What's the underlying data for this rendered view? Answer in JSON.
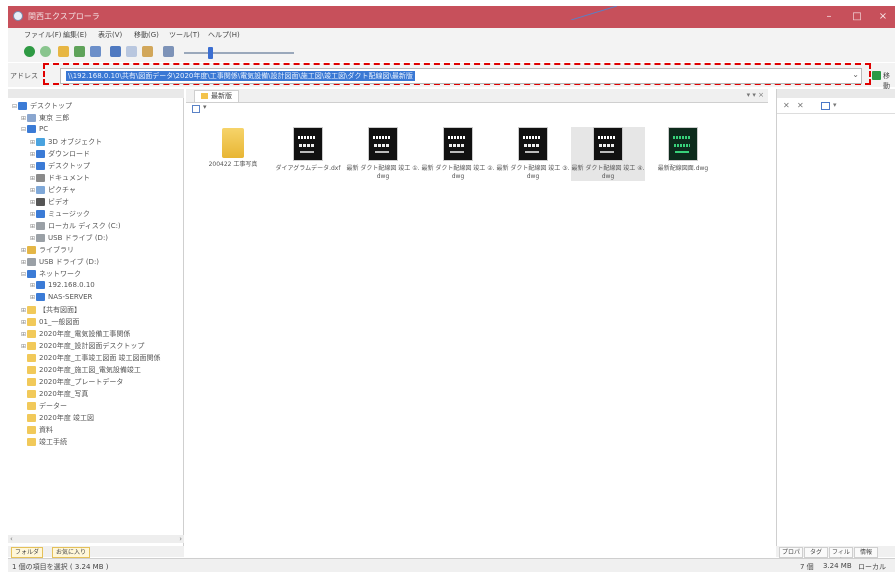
{
  "window": {
    "title": "関西エクスプローラ",
    "minimize": "–",
    "maximize": "□",
    "close": "×"
  },
  "menu": [
    "ファイル(F)",
    "編集(E)",
    "表示(V)",
    "移動(G)",
    "ツール(T)",
    "ヘルプ(H)"
  ],
  "toolbar": {
    "icons": [
      "back-icon",
      "forward-icon",
      "up-folder-icon",
      "home-icon",
      "refresh-icon",
      "copy-icon",
      "paste-icon",
      "delete-icon",
      "view-mode-icon"
    ]
  },
  "address": {
    "label": "アドレス",
    "value": "\\\\192.168.0.10\\共有\\図面データ\\2020年度\\工事関係\\電気設備\\設計図面\\施工図\\竣工図\\ダクト配線図\\最新版",
    "go_label": "移動"
  },
  "tree": {
    "items": [
      {
        "label": "デスクトップ",
        "icon": "desktop-icon",
        "color": "#3b7bd6",
        "indent": 0,
        "exp": "⊟"
      },
      {
        "label": "東京 三郎",
        "icon": "user-icon",
        "color": "#8aa6cf",
        "indent": 1,
        "exp": "⊞"
      },
      {
        "label": "PC",
        "icon": "pc-icon",
        "color": "#3b7bd6",
        "indent": 1,
        "exp": "⊟"
      },
      {
        "label": "3D オブジェクト",
        "icon": "3d-objects-icon",
        "color": "#4aa3df",
        "indent": 2,
        "exp": "⊞"
      },
      {
        "label": "ダウンロード",
        "icon": "download-icon",
        "color": "#3b7bd6",
        "indent": 2,
        "exp": "⊞"
      },
      {
        "label": "デスクトップ",
        "icon": "desktop-icon",
        "color": "#3b7bd6",
        "indent": 2,
        "exp": "⊞"
      },
      {
        "label": "ドキュメント",
        "icon": "documents-icon",
        "color": "#8a8a8a",
        "indent": 2,
        "exp": "⊞"
      },
      {
        "label": "ピクチャ",
        "icon": "pictures-icon",
        "color": "#7fa8d8",
        "indent": 2,
        "exp": "⊞"
      },
      {
        "label": "ビデオ",
        "icon": "videos-icon",
        "color": "#555555",
        "indent": 2,
        "exp": "⊞"
      },
      {
        "label": "ミュージック",
        "icon": "music-icon",
        "color": "#3b7bd6",
        "indent": 2,
        "exp": "⊞"
      },
      {
        "label": "ローカル ディスク (C:)",
        "icon": "drive-icon",
        "color": "#9aa0a6",
        "indent": 2,
        "exp": "⊞"
      },
      {
        "label": "USB ドライブ (D:)",
        "icon": "usb-drive-icon",
        "color": "#9aa0a6",
        "indent": 2,
        "exp": "⊞"
      },
      {
        "label": "ライブラリ",
        "icon": "library-icon",
        "color": "#e4b646",
        "indent": 1,
        "exp": "⊞"
      },
      {
        "label": "USB ドライブ (D:)",
        "icon": "usb-drive-icon",
        "color": "#9aa0a6",
        "indent": 1,
        "exp": "⊞"
      },
      {
        "label": "ネットワーク",
        "icon": "network-icon",
        "color": "#3b7bd6",
        "indent": 1,
        "exp": "⊟"
      },
      {
        "label": "192.168.0.10",
        "icon": "server-icon",
        "color": "#3b7bd6",
        "indent": 2,
        "exp": "⊞"
      },
      {
        "label": "NAS-SERVER",
        "icon": "server-icon",
        "color": "#3b7bd6",
        "indent": 2,
        "exp": "⊞"
      },
      {
        "label": "【共有図面】",
        "icon": "folder-icon",
        "color": "#f1c95a",
        "indent": 1,
        "exp": "⊞"
      },
      {
        "label": "01_一般図面",
        "icon": "folder-icon",
        "color": "#f1c95a",
        "indent": 1,
        "exp": "⊞"
      },
      {
        "label": "2020年度_電気設備工事関係",
        "icon": "folder-icon",
        "color": "#f1c95a",
        "indent": 1,
        "exp": "⊞"
      },
      {
        "label": "2020年度_設計図面デスクトップ",
        "icon": "folder-icon",
        "color": "#f1c95a",
        "indent": 1,
        "exp": "⊞"
      },
      {
        "label": "2020年度_工事竣工図面 竣工図面関係",
        "icon": "folder-icon",
        "color": "#f1c95a",
        "indent": 1,
        "exp": ""
      },
      {
        "label": "2020年度_施工図_電気設備竣工",
        "icon": "folder-icon",
        "color": "#f1c95a",
        "indent": 1,
        "exp": ""
      },
      {
        "label": "2020年度_プレートデータ",
        "icon": "folder-icon",
        "color": "#f1c95a",
        "indent": 1,
        "exp": ""
      },
      {
        "label": "2020年度_写真",
        "icon": "folder-icon",
        "color": "#f1c95a",
        "indent": 1,
        "exp": ""
      },
      {
        "label": "データー",
        "icon": "folder-icon",
        "color": "#f1c95a",
        "indent": 1,
        "exp": ""
      },
      {
        "label": "2020年度 竣工図",
        "icon": "folder-icon",
        "color": "#f1c95a",
        "indent": 1,
        "exp": ""
      },
      {
        "label": "資料",
        "icon": "folder-icon",
        "color": "#f1c95a",
        "indent": 1,
        "exp": ""
      },
      {
        "label": "竣工手続",
        "icon": "folder-icon",
        "color": "#f1c95a",
        "indent": 1,
        "exp": ""
      }
    ]
  },
  "main": {
    "tab_label": "最新版",
    "tab_controls": "▾ ▾ ×",
    "files": [
      {
        "name": "200422 工事写真",
        "kind": "folder"
      },
      {
        "name": "ダイアグラムデータ.dxf",
        "kind": "drawing"
      },
      {
        "name": "最新 ダクト配線図 竣工 ①.dwg",
        "kind": "drawing"
      },
      {
        "name": "最新 ダクト配線図 竣工 ②.dwg",
        "kind": "drawing"
      },
      {
        "name": "最新 ダクト配線図 竣工 ③.dwg",
        "kind": "drawing"
      },
      {
        "name": "最新 ダクト配線図 竣工 ④.dwg",
        "kind": "drawing-selected"
      },
      {
        "name": "最新配線図面.dwg",
        "kind": "drawing-green"
      }
    ]
  },
  "left_tabs": [
    "フォルダ",
    "お気に入り"
  ],
  "right_tabs": [
    "プロパティ",
    "タグ",
    "フィルタ",
    "情報"
  ],
  "status": {
    "left": "1 個の項目を選択 ( 3.24 MB )",
    "right_items": "7 個",
    "right_size": "3.24 MB",
    "right_zone": "ローカル"
  }
}
